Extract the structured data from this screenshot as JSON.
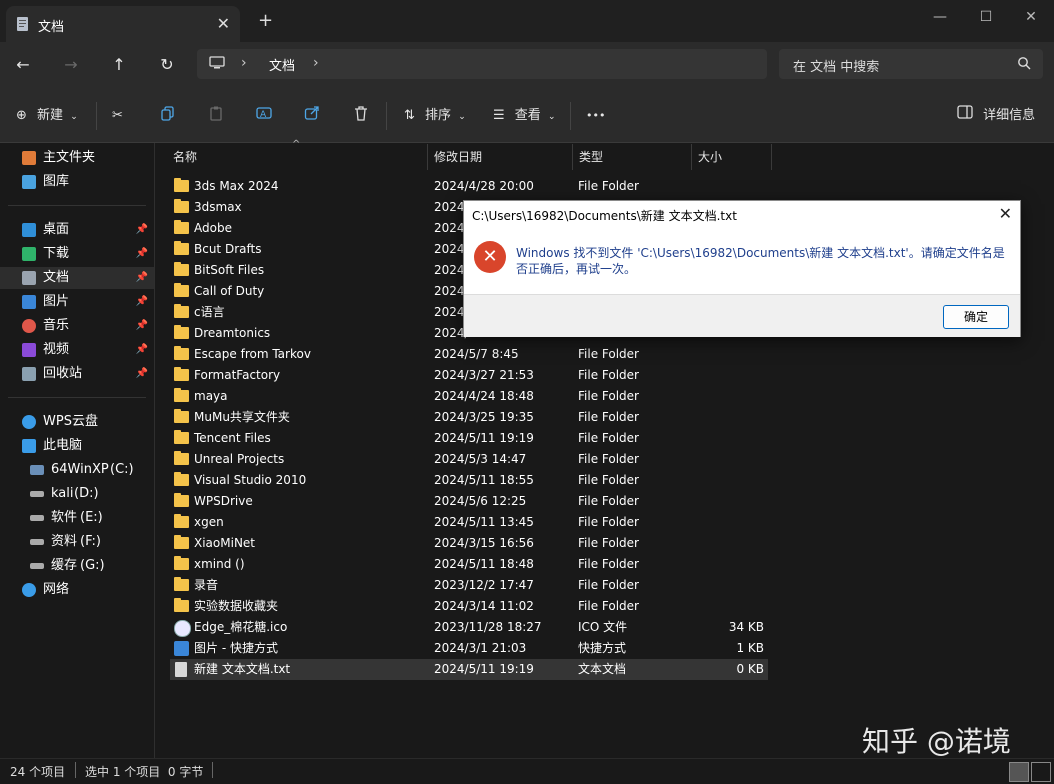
{
  "tab": {
    "title": "文档",
    "close": "✕",
    "new_tab": "+"
  },
  "window": {
    "minimize": "—",
    "maximize": "☐",
    "close": "✕"
  },
  "address": {
    "crumbs": [
      "文档"
    ],
    "sep": "›"
  },
  "search": {
    "placeholder": "在 文档 中搜索"
  },
  "toolbar": {
    "new_label": "新建",
    "sort_label": "排序",
    "view_label": "查看",
    "more_label": "•••",
    "details_label": "详细信息"
  },
  "sidebar": {
    "quick": [
      {
        "label": "主文件夹",
        "color": "#e07b39"
      },
      {
        "label": "图库",
        "color": "#4aa3e0"
      }
    ],
    "pinned": [
      {
        "label": "桌面",
        "color": "#2f8fd8",
        "pin": true
      },
      {
        "label": "下载",
        "color": "#2fb36a",
        "pin": true
      },
      {
        "label": "文档",
        "color": "#9aa4b0",
        "pin": true
      },
      {
        "label": "图片",
        "color": "#3a86d8",
        "pin": true
      },
      {
        "label": "音乐",
        "color": "#e0574a",
        "pin": true
      },
      {
        "label": "视频",
        "color": "#8a4ad8",
        "pin": true
      },
      {
        "label": "回收站",
        "color": "#8aa0b0",
        "pin": true
      }
    ],
    "wps": "WPS云盘",
    "pc": "此电脑",
    "drives": [
      {
        "label": "64WinXP",
        "letter": "(C:)"
      },
      {
        "label": "kali",
        "letter": "(D:)"
      },
      {
        "label": "软件",
        "letter": "(E:)"
      },
      {
        "label": "资料",
        "letter": "(F:)"
      },
      {
        "label": "缓存",
        "letter": "(G:)"
      }
    ],
    "network": "网络"
  },
  "columns": {
    "name": "名称",
    "date": "修改日期",
    "type": "类型",
    "size": "大小"
  },
  "files": [
    {
      "name": "3ds Max 2024",
      "date": "2024/4/28 20:00",
      "type": "File Folder",
      "size": ""
    },
    {
      "name": "3dsmax",
      "date": "2024/",
      "type": "",
      "size": ""
    },
    {
      "name": "Adobe",
      "date": "2024/",
      "type": "",
      "size": ""
    },
    {
      "name": "Bcut Drafts",
      "date": "2024/",
      "type": "",
      "size": ""
    },
    {
      "name": "BitSoft Files",
      "date": "2024/",
      "type": "",
      "size": ""
    },
    {
      "name": "Call of Duty",
      "date": "2024/",
      "type": "",
      "size": ""
    },
    {
      "name": "c语言",
      "date": "2024/",
      "type": "",
      "size": ""
    },
    {
      "name": "Dreamtonics",
      "date": "2024/",
      "type": "",
      "size": ""
    },
    {
      "name": "Escape from Tarkov",
      "date": "2024/5/7 8:45",
      "type": "File Folder",
      "size": ""
    },
    {
      "name": "FormatFactory",
      "date": "2024/3/27 21:53",
      "type": "File Folder",
      "size": ""
    },
    {
      "name": "maya",
      "date": "2024/4/24 18:48",
      "type": "File Folder",
      "size": ""
    },
    {
      "name": "MuMu共享文件夹",
      "date": "2024/3/25 19:35",
      "type": "File Folder",
      "size": ""
    },
    {
      "name": "Tencent Files",
      "date": "2024/5/11 19:19",
      "type": "File Folder",
      "size": ""
    },
    {
      "name": "Unreal Projects",
      "date": "2024/5/3 14:47",
      "type": "File Folder",
      "size": ""
    },
    {
      "name": "Visual Studio 2010",
      "date": "2024/5/11 18:55",
      "type": "File Folder",
      "size": ""
    },
    {
      "name": "WPSDrive",
      "date": "2024/5/6 12:25",
      "type": "File Folder",
      "size": ""
    },
    {
      "name": "xgen",
      "date": "2024/5/11 13:45",
      "type": "File Folder",
      "size": ""
    },
    {
      "name": "XiaoMiNet",
      "date": "2024/3/15 16:56",
      "type": "File Folder",
      "size": ""
    },
    {
      "name": "xmind ()",
      "date": "2024/5/11 18:48",
      "type": "File Folder",
      "size": ""
    },
    {
      "name": "录音",
      "date": "2023/12/2 17:47",
      "type": "File Folder",
      "size": ""
    },
    {
      "name": "实验数据收藏夹",
      "date": "2024/3/14 11:02",
      "type": "File Folder",
      "size": ""
    },
    {
      "name": "Edge_棉花糖.ico",
      "date": "2023/11/28 18:27",
      "type": "ICO 文件",
      "size": "34 KB"
    },
    {
      "name": "图片 - 快捷方式",
      "date": "2024/3/1 21:03",
      "type": "快捷方式",
      "size": "1 KB"
    },
    {
      "name": "新建 文本文档.txt",
      "date": "2024/5/11 19:19",
      "type": "文本文档",
      "size": "0 KB"
    }
  ],
  "status": {
    "count": "24 个项目",
    "selected": "选中 1 个项目  0 字节"
  },
  "dialog": {
    "title": "C:\\Users\\16982\\Documents\\新建 文本文档.txt",
    "message": "Windows 找不到文件 'C:\\Users\\16982\\Documents\\新建 文本文档.txt'。请确定文件名是否正确后，再试一次。",
    "ok": "确定",
    "close": "✕",
    "icon": "✕"
  },
  "watermark": "知乎 @诺境"
}
